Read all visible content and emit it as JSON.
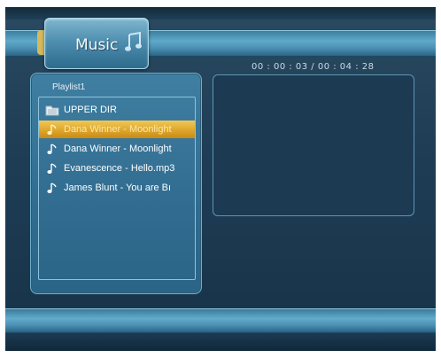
{
  "header": {
    "title": "Music",
    "icon": "music-note-icon"
  },
  "playlist": {
    "label": "Playlist1",
    "items": [
      {
        "label": "UPPER DIR",
        "icon": "folder-up-icon",
        "selected": false
      },
      {
        "label": "Dana Winner - Moonlight",
        "icon": "music-note-icon",
        "selected": true
      },
      {
        "label": "Dana Winner - Moonlight",
        "icon": "music-note-icon",
        "selected": false
      },
      {
        "label": "Evanescence - Hello.mp3",
        "icon": "music-note-icon",
        "selected": false
      },
      {
        "label": "James Blunt - You are Bı",
        "icon": "music-note-icon",
        "selected": false
      }
    ]
  },
  "player": {
    "time": "00 : 00 : 03 / 00 : 04 : 28"
  },
  "colors": {
    "background": "#1e3d55",
    "accent": "#4a8fb3",
    "selection": "#e0a92e"
  }
}
